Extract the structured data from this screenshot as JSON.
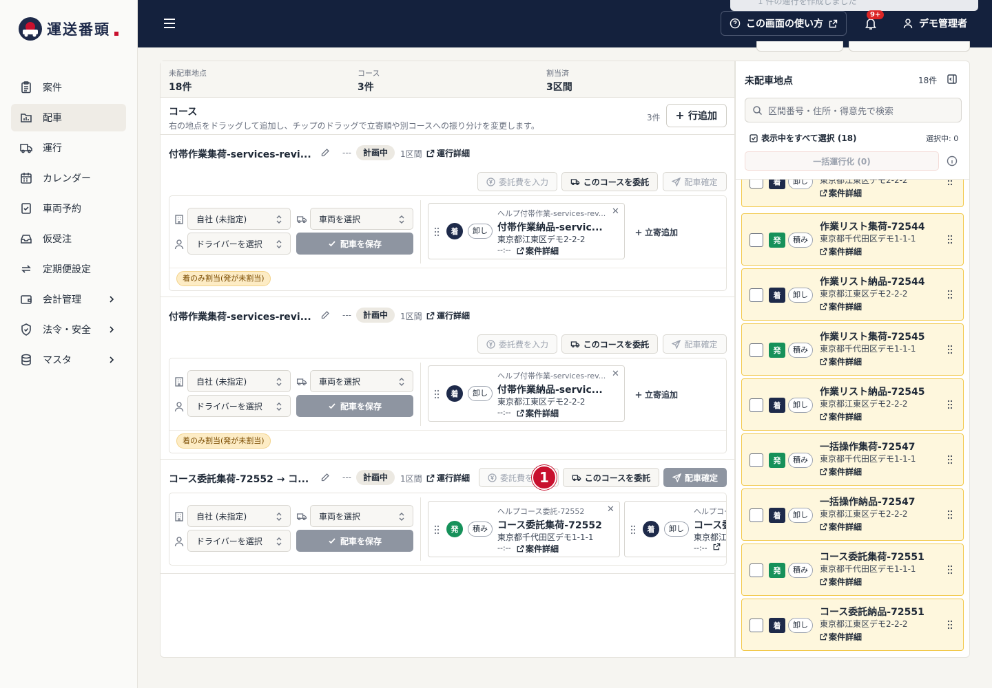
{
  "app": {
    "logo_text": "運送番頭"
  },
  "toast": {
    "text": "1 件の運行を作成しました"
  },
  "header": {
    "help_label": "この画面の使い方",
    "notification_badge": "9+",
    "user_name": "デモ管理者"
  },
  "sidebar": {
    "items": [
      {
        "label": "案件",
        "icon": "clipboard-icon"
      },
      {
        "label": "配車",
        "icon": "dispatch-icon"
      },
      {
        "label": "運行",
        "icon": "truck-icon"
      },
      {
        "label": "カレンダー",
        "icon": "calendar-icon"
      },
      {
        "label": "車両予約",
        "icon": "calendar-check-icon"
      },
      {
        "label": "仮受注",
        "icon": "inbox-icon"
      },
      {
        "label": "定期便設定",
        "icon": "repeat-icon"
      },
      {
        "label": "会計管理",
        "icon": "wallet-icon"
      },
      {
        "label": "法令・安全",
        "icon": "shield-icon"
      },
      {
        "label": "マスタ",
        "icon": "database-icon"
      }
    ]
  },
  "stats": {
    "unassigned_label": "未配車地点",
    "unassigned_value": "18件",
    "courses_label": "コース",
    "courses_value": "3件",
    "assigned_label": "割当済",
    "assigned_value": "3区間"
  },
  "course_section": {
    "title": "コース",
    "description": "右の地点をドラッグして追加し、チップのドラッグで立寄順や別コースへの振り分けを変更します。",
    "count": "3件",
    "add_row_label": "行追加"
  },
  "common": {
    "dash": "---",
    "detail_link": "運行詳細",
    "fee_button": "委託費を入力",
    "fee_button_short": "委託費を",
    "consign_button": "このコースを委託",
    "confirm_button": "配車確定",
    "company_select": "自社 (未指定)",
    "vehicle_select": "車両を選択",
    "driver_select": "ドライバーを選択",
    "save_button": "配車を保存",
    "add_stop": "立寄追加",
    "case_detail": "案件詳細",
    "time": "--:--",
    "warning": "着のみ割当(発が未割当)"
  },
  "courses": [
    {
      "title": "付帯作業集荷-services-revi...",
      "status": "計画中",
      "sections": "1区間",
      "stops": [
        {
          "help": "ヘルプ付帯作業-services-rev...",
          "type": "着",
          "action": "卸し",
          "name": "付帯作業納品-servic...",
          "address": "東京都江東区デモ2-2-2"
        }
      ]
    },
    {
      "title": "付帯作業集荷-services-revi...",
      "status": "計画中",
      "sections": "1区間",
      "stops": [
        {
          "help": "ヘルプ付帯作業-services-rev...",
          "type": "着",
          "action": "卸し",
          "name": "付帯作業納品-servic...",
          "address": "東京都江東区デモ2-2-2"
        }
      ]
    },
    {
      "title": "コース委託集荷-72552 → コ...",
      "status": "計画中",
      "sections": "1区間",
      "stops": [
        {
          "help": "ヘルプコース委託-72552",
          "type": "発",
          "action": "積み",
          "name": "コース委託集荷-72552",
          "address": "東京都千代田区デモ1-1-1"
        },
        {
          "help": "ヘルプコー",
          "type": "着",
          "action": "卸し",
          "name": "コース委",
          "address": "東京都江"
        }
      ]
    }
  ],
  "step_badge": "1",
  "right_panel": {
    "title": "未配車地点",
    "count": "18件",
    "search_placeholder": "区間番号・住所・得意先で検索",
    "select_all": "表示中をすべて選択 (18)",
    "selected": "選択中: 0",
    "bulk_button": "一括運行化 (0)",
    "items": [
      {
        "type": "着",
        "action": "卸し",
        "name": "",
        "address": "東京都江東区デモ2-2-2"
      },
      {
        "type": "発",
        "action": "積み",
        "name": "作業リスト集荷-72544",
        "address": "東京都千代田区デモ1-1-1"
      },
      {
        "type": "着",
        "action": "卸し",
        "name": "作業リスト納品-72544",
        "address": "東京都江東区デモ2-2-2"
      },
      {
        "type": "発",
        "action": "積み",
        "name": "作業リスト集荷-72545",
        "address": "東京都千代田区デモ1-1-1"
      },
      {
        "type": "着",
        "action": "卸し",
        "name": "作業リスト納品-72545",
        "address": "東京都江東区デモ2-2-2"
      },
      {
        "type": "発",
        "action": "積み",
        "name": "一括操作集荷-72547",
        "address": "東京都千代田区デモ1-1-1"
      },
      {
        "type": "着",
        "action": "卸し",
        "name": "一括操作納品-72547",
        "address": "東京都江東区デモ2-2-2"
      },
      {
        "type": "発",
        "action": "積み",
        "name": "コース委託集荷-72551",
        "address": "東京都千代田区デモ1-1-1"
      },
      {
        "type": "着",
        "action": "卸し",
        "name": "コース委託納品-72551",
        "address": "東京都江東区デモ2-2-2"
      }
    ]
  }
}
